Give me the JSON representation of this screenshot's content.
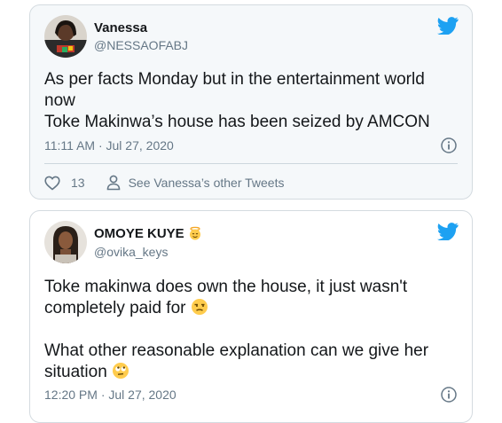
{
  "tweets": [
    {
      "name": "Vanessa",
      "handle": "@NESSAOFABJ",
      "text_lines": [
        "As per facts Monday but in the entertainment world",
        "now",
        "Toke Makinwa’s house has been seized by AMCON"
      ],
      "timestamp": "11:11 AM · Jul 27, 2020",
      "like_count": "13",
      "see_more_label": "See Vanessa’s other Tweets"
    },
    {
      "name": "OMOYE KUYE",
      "handle": "@ovika_keys",
      "text_lines": [
        "Toke makinwa does own the house, it just wasn't",
        "completely paid for",
        "",
        "What other reasonable explanation can we give her",
        "situation"
      ],
      "timestamp": "12:20 PM · Jul 27, 2020"
    }
  ],
  "colors": {
    "twitter_blue": "#1da1f2",
    "secondary_text": "#657786",
    "primary_text": "#14171a",
    "card_border": "#d4dbe0"
  },
  "icons": [
    "twitter-bird-icon",
    "info-icon",
    "heart-icon",
    "person-icon",
    "emoji-icon"
  ]
}
